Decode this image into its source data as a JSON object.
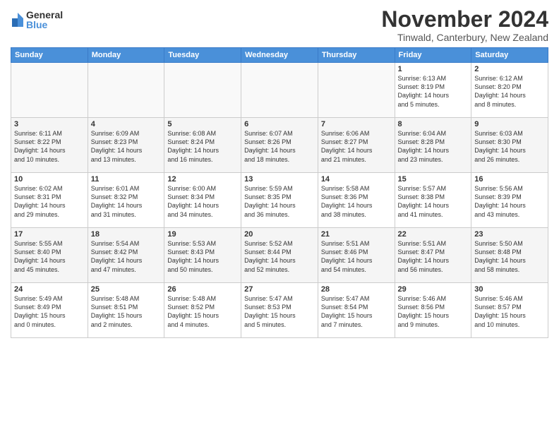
{
  "logo": {
    "general": "General",
    "blue": "Blue"
  },
  "title": "November 2024",
  "location": "Tinwald, Canterbury, New Zealand",
  "days_of_week": [
    "Sunday",
    "Monday",
    "Tuesday",
    "Wednesday",
    "Thursday",
    "Friday",
    "Saturday"
  ],
  "weeks": [
    [
      {
        "day": "",
        "info": ""
      },
      {
        "day": "",
        "info": ""
      },
      {
        "day": "",
        "info": ""
      },
      {
        "day": "",
        "info": ""
      },
      {
        "day": "",
        "info": ""
      },
      {
        "day": "1",
        "info": "Sunrise: 6:13 AM\nSunset: 8:19 PM\nDaylight: 14 hours\nand 5 minutes."
      },
      {
        "day": "2",
        "info": "Sunrise: 6:12 AM\nSunset: 8:20 PM\nDaylight: 14 hours\nand 8 minutes."
      }
    ],
    [
      {
        "day": "3",
        "info": "Sunrise: 6:11 AM\nSunset: 8:22 PM\nDaylight: 14 hours\nand 10 minutes."
      },
      {
        "day": "4",
        "info": "Sunrise: 6:09 AM\nSunset: 8:23 PM\nDaylight: 14 hours\nand 13 minutes."
      },
      {
        "day": "5",
        "info": "Sunrise: 6:08 AM\nSunset: 8:24 PM\nDaylight: 14 hours\nand 16 minutes."
      },
      {
        "day": "6",
        "info": "Sunrise: 6:07 AM\nSunset: 8:26 PM\nDaylight: 14 hours\nand 18 minutes."
      },
      {
        "day": "7",
        "info": "Sunrise: 6:06 AM\nSunset: 8:27 PM\nDaylight: 14 hours\nand 21 minutes."
      },
      {
        "day": "8",
        "info": "Sunrise: 6:04 AM\nSunset: 8:28 PM\nDaylight: 14 hours\nand 23 minutes."
      },
      {
        "day": "9",
        "info": "Sunrise: 6:03 AM\nSunset: 8:30 PM\nDaylight: 14 hours\nand 26 minutes."
      }
    ],
    [
      {
        "day": "10",
        "info": "Sunrise: 6:02 AM\nSunset: 8:31 PM\nDaylight: 14 hours\nand 29 minutes."
      },
      {
        "day": "11",
        "info": "Sunrise: 6:01 AM\nSunset: 8:32 PM\nDaylight: 14 hours\nand 31 minutes."
      },
      {
        "day": "12",
        "info": "Sunrise: 6:00 AM\nSunset: 8:34 PM\nDaylight: 14 hours\nand 34 minutes."
      },
      {
        "day": "13",
        "info": "Sunrise: 5:59 AM\nSunset: 8:35 PM\nDaylight: 14 hours\nand 36 minutes."
      },
      {
        "day": "14",
        "info": "Sunrise: 5:58 AM\nSunset: 8:36 PM\nDaylight: 14 hours\nand 38 minutes."
      },
      {
        "day": "15",
        "info": "Sunrise: 5:57 AM\nSunset: 8:38 PM\nDaylight: 14 hours\nand 41 minutes."
      },
      {
        "day": "16",
        "info": "Sunrise: 5:56 AM\nSunset: 8:39 PM\nDaylight: 14 hours\nand 43 minutes."
      }
    ],
    [
      {
        "day": "17",
        "info": "Sunrise: 5:55 AM\nSunset: 8:40 PM\nDaylight: 14 hours\nand 45 minutes."
      },
      {
        "day": "18",
        "info": "Sunrise: 5:54 AM\nSunset: 8:42 PM\nDaylight: 14 hours\nand 47 minutes."
      },
      {
        "day": "19",
        "info": "Sunrise: 5:53 AM\nSunset: 8:43 PM\nDaylight: 14 hours\nand 50 minutes."
      },
      {
        "day": "20",
        "info": "Sunrise: 5:52 AM\nSunset: 8:44 PM\nDaylight: 14 hours\nand 52 minutes."
      },
      {
        "day": "21",
        "info": "Sunrise: 5:51 AM\nSunset: 8:46 PM\nDaylight: 14 hours\nand 54 minutes."
      },
      {
        "day": "22",
        "info": "Sunrise: 5:51 AM\nSunset: 8:47 PM\nDaylight: 14 hours\nand 56 minutes."
      },
      {
        "day": "23",
        "info": "Sunrise: 5:50 AM\nSunset: 8:48 PM\nDaylight: 14 hours\nand 58 minutes."
      }
    ],
    [
      {
        "day": "24",
        "info": "Sunrise: 5:49 AM\nSunset: 8:49 PM\nDaylight: 15 hours\nand 0 minutes."
      },
      {
        "day": "25",
        "info": "Sunrise: 5:48 AM\nSunset: 8:51 PM\nDaylight: 15 hours\nand 2 minutes."
      },
      {
        "day": "26",
        "info": "Sunrise: 5:48 AM\nSunset: 8:52 PM\nDaylight: 15 hours\nand 4 minutes."
      },
      {
        "day": "27",
        "info": "Sunrise: 5:47 AM\nSunset: 8:53 PM\nDaylight: 15 hours\nand 5 minutes."
      },
      {
        "day": "28",
        "info": "Sunrise: 5:47 AM\nSunset: 8:54 PM\nDaylight: 15 hours\nand 7 minutes."
      },
      {
        "day": "29",
        "info": "Sunrise: 5:46 AM\nSunset: 8:56 PM\nDaylight: 15 hours\nand 9 minutes."
      },
      {
        "day": "30",
        "info": "Sunrise: 5:46 AM\nSunset: 8:57 PM\nDaylight: 15 hours\nand 10 minutes."
      }
    ]
  ]
}
